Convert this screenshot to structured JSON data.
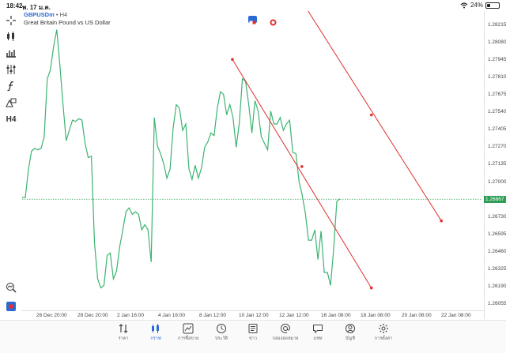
{
  "status": {
    "time": "18:42",
    "date": "พ. 17 ม.ค.",
    "battery": "24%",
    "battery_level": 0.24
  },
  "symbol": {
    "name": "GBPUSDm",
    "timeframe": "• H4",
    "description": "Great Britain Pound vs US Dollar"
  },
  "toolbar": {
    "items": [
      {
        "icon": "crosshair-icon"
      },
      {
        "icon": "candlestick-icon"
      },
      {
        "icon": "bar-chart-icon"
      },
      {
        "icon": "indicators-icon"
      },
      {
        "icon": "function-icon"
      },
      {
        "icon": "objects-icon"
      },
      {
        "label": "H4"
      }
    ]
  },
  "price_axis": {
    "labels": [
      "1.28215",
      "1.28080",
      "1.27945",
      "1.27810",
      "1.27675",
      "1.27540",
      "1.27405",
      "1.27270",
      "1.27135",
      "1.27000",
      "1.26865",
      "1.26730",
      "1.26595",
      "1.26460",
      "1.26325",
      "1.26190",
      "1.26055"
    ],
    "current": "1.26867",
    "current_color": "#2e9e55"
  },
  "time_axis": {
    "labels": [
      "26 Dec 20:00",
      "28 Dec 20:00",
      "2 Jan 16:00",
      "4 Jan 16:00",
      "8 Jan 12:00",
      "10 Jan 12:00",
      "12 Jan 12:00",
      "16 Jan 08:00",
      "18 Jan 08:00",
      "20 Jan 08:00",
      "22 Jan 08:00"
    ]
  },
  "chart_data": {
    "type": "line",
    "series": [
      {
        "color": "#3cb371",
        "values": [
          1.2688,
          1.2688,
          1.271,
          1.2724,
          1.2726,
          1.2725,
          1.2726,
          1.2735,
          1.278,
          1.2787,
          1.2805,
          1.2818,
          1.279,
          1.276,
          1.2732,
          1.274,
          1.2748,
          1.2747,
          1.2749,
          1.2748,
          1.273,
          1.2719,
          1.272,
          1.2653,
          1.2625,
          1.2618,
          1.262,
          1.2643,
          1.2645,
          1.2625,
          1.2631,
          1.265,
          1.2663,
          1.2677,
          1.268,
          1.2675,
          1.2677,
          1.2675,
          1.2663,
          1.2667,
          1.2663,
          1.2638,
          1.275,
          1.2728,
          1.2722,
          1.2714,
          1.2703,
          1.271,
          1.2742,
          1.276,
          1.2757,
          1.274,
          1.2745,
          1.271,
          1.2702,
          1.2713,
          1.2703,
          1.2711,
          1.2727,
          1.2731,
          1.2738,
          1.2736,
          1.2757,
          1.277,
          1.2768,
          1.2752,
          1.276,
          1.275,
          1.2727,
          1.2745,
          1.278,
          1.2778,
          1.276,
          1.2738,
          1.2763,
          1.2755,
          1.2735,
          1.273,
          1.2725,
          1.2755,
          1.2745,
          1.2745,
          1.275,
          1.274,
          1.2745,
          1.2748,
          1.2723,
          1.2722,
          1.27,
          1.269,
          1.2676,
          1.2655,
          1.2655,
          1.2663,
          1.264,
          1.2662,
          1.263,
          1.263,
          1.262,
          1.2648,
          1.2685,
          1.2687
        ]
      }
    ],
    "trendlines": [
      {
        "color": "#e03030",
        "from": {
          "x": 0.457,
          "y": 1.2795
        },
        "mid": {
          "x": 0.608,
          "y": 1.2712
        },
        "to": {
          "x": 0.759,
          "y": 1.2618
        }
      },
      {
        "color": "#e03030",
        "from": {
          "x": 0.608,
          "y": 1.284
        },
        "mid": {
          "x": 0.759,
          "y": 1.2752
        },
        "to": {
          "x": 0.911,
          "y": 1.267
        }
      }
    ],
    "ylim": [
      1.26,
      1.283
    ],
    "grid": false
  },
  "tabs": [
    {
      "label": "ราคา",
      "icon": "quotes-icon"
    },
    {
      "label": "กราฟ",
      "icon": "chart-icon",
      "active": true
    },
    {
      "label": "การซื้อขาย",
      "icon": "trade-icon"
    },
    {
      "label": "ประวัติ",
      "icon": "history-icon"
    },
    {
      "label": "ข่าว",
      "icon": "news-icon"
    },
    {
      "label": "กล่องจดหมาย",
      "icon": "mailbox-icon"
    },
    {
      "label": "แชท",
      "icon": "chat-icon"
    },
    {
      "label": "บัญชี",
      "icon": "account-icon"
    },
    {
      "label": "การตั้งค่า",
      "icon": "settings-icon"
    }
  ]
}
